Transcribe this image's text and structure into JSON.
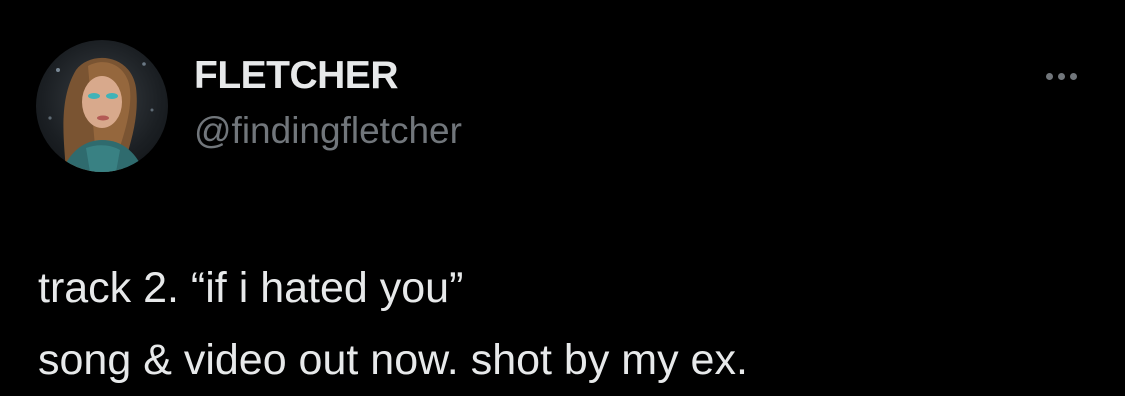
{
  "author": {
    "display_name": "FLETCHER",
    "handle": "@findingfletcher",
    "avatar_icon": "profile-photo"
  },
  "menu": {
    "icon": "more-options-icon"
  },
  "tweet": {
    "lines": [
      "track 2. “if i hated you”",
      "song & video out now. shot by my ex."
    ]
  },
  "colors": {
    "background": "#000000",
    "primary_text": "#e7e9ea",
    "secondary_text": "#71767b"
  }
}
